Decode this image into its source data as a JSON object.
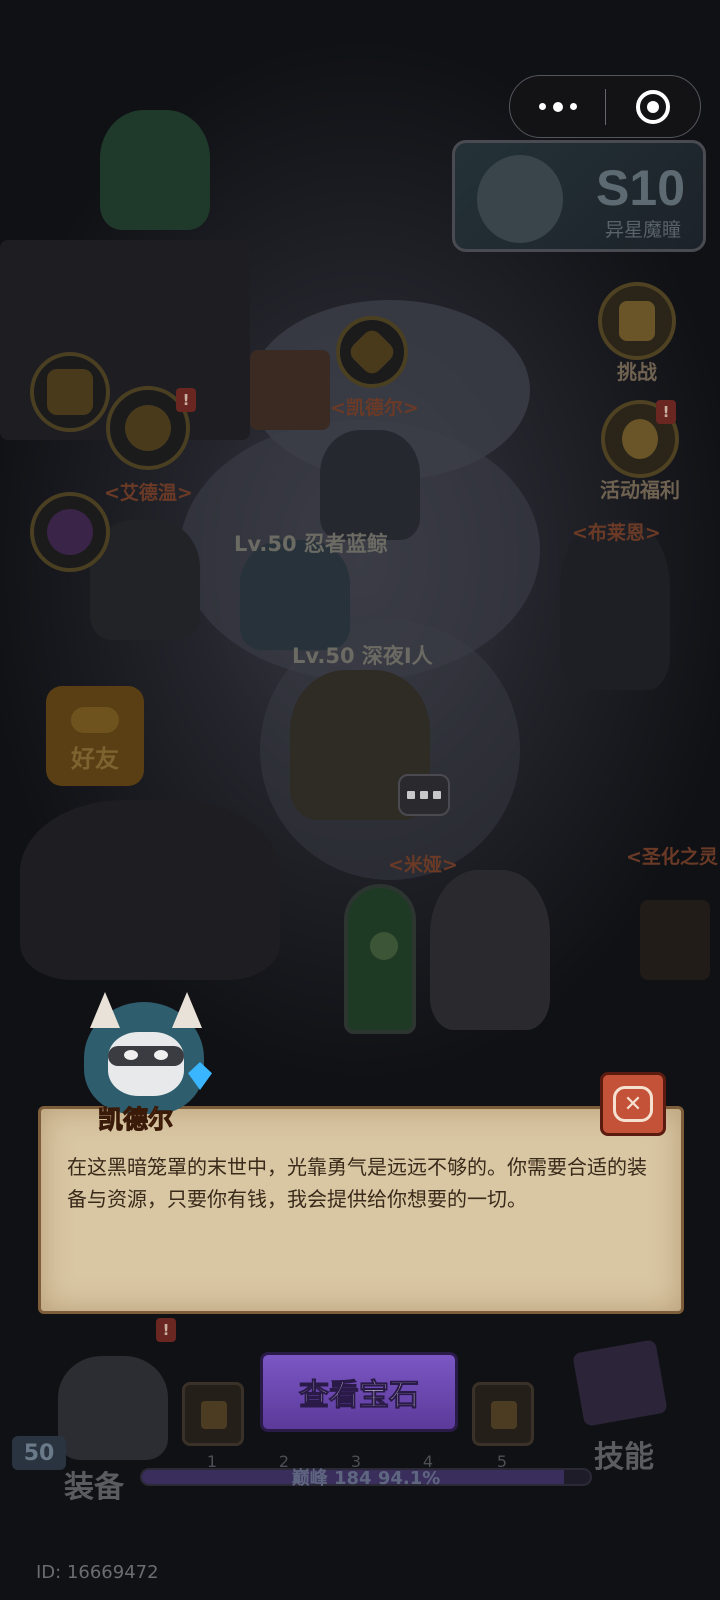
{
  "top_bar": {
    "more_icon": "more-dots-icon",
    "close_icon": "target-circle-icon"
  },
  "season": {
    "number": "S10",
    "subtitle": "异星魔瞳"
  },
  "right_menu": [
    {
      "label": "挑战",
      "icon": "hammer-icon"
    },
    {
      "label": "活动福利",
      "icon": "lantern-icon",
      "badge": "!"
    }
  ],
  "left_menu": {
    "badge": "!"
  },
  "world": {
    "npc_names": [
      "<凯德尔>",
      "<艾德温>",
      "<布莱恩>",
      "<米娅>",
      "<圣化之灵"
    ],
    "player_tags": [
      "Lv.50 忍者蓝鲸",
      "Lv.50 深夜I人"
    ]
  },
  "friend_button": {
    "label": "好友"
  },
  "dialog": {
    "speaker": "凯德尔",
    "text": "在这黑暗笼罩的末世中，光靠勇气是远远不够的。你需要合适的装备与资源，只要你有钱，我会提供给你想要的一切。",
    "close_icon": "close-chat-icon"
  },
  "bottom_bar": {
    "level": "50",
    "equip_label": "装备",
    "skill_label": "技能",
    "view_gem_label": "查看宝石",
    "slot_numbers": [
      "1",
      "2",
      "3",
      "4",
      "5"
    ],
    "badge": "!",
    "xp_text": "巅峰 184  94.1%",
    "xp_progress": 0.941
  },
  "footer": {
    "id_text": "ID: 16669472"
  }
}
